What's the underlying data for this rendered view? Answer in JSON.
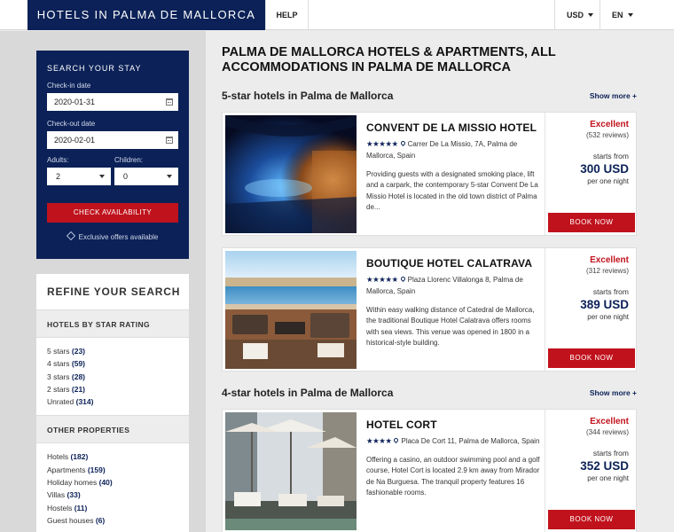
{
  "header": {
    "logo": "HOTELS IN PALMA DE MALLORCA",
    "help": "HELP",
    "currency": "USD",
    "language": "EN"
  },
  "search": {
    "title": "SEARCH YOUR STAY",
    "checkin_label": "Check-in date",
    "checkin_value": "2020-01-31",
    "checkout_label": "Check-out date",
    "checkout_value": "2020-02-01",
    "adults_label": "Adults:",
    "adults_value": "2",
    "children_label": "Children:",
    "children_value": "0",
    "button": "CHECK AVAILABILITY",
    "exclusive": "Exclusive offers available"
  },
  "refine": {
    "title": "REFINE YOUR SEARCH",
    "star_heading": "HOTELS BY STAR RATING",
    "star_items": [
      {
        "label": "5 stars",
        "count": "(23)"
      },
      {
        "label": "4 stars",
        "count": "(59)"
      },
      {
        "label": "3 stars",
        "count": "(28)"
      },
      {
        "label": "2 stars",
        "count": "(21)"
      },
      {
        "label": "Unrated",
        "count": "(314)"
      }
    ],
    "other_heading": "OTHER PROPERTIES",
    "other_items": [
      {
        "label": "Hotels",
        "count": "(182)"
      },
      {
        "label": "Apartments",
        "count": "(159)"
      },
      {
        "label": "Holiday homes",
        "count": "(40)"
      },
      {
        "label": "Villas",
        "count": "(33)"
      },
      {
        "label": "Hostels",
        "count": "(11)"
      },
      {
        "label": "Guest houses",
        "count": "(6)"
      }
    ]
  },
  "main": {
    "title": "PALMA DE MALLORCA HOTELS & APARTMENTS, ALL ACCOMMODATIONS IN PALMA DE MALLORCA",
    "section5": "5-star hotels in Palma de Mallorca",
    "section4": "4-star hotels in Palma de Mallorca",
    "show_more": "Show more +"
  },
  "hotels": [
    {
      "name": "CONVENT DE LA MISSIO HOTEL",
      "stars": "★★★★★",
      "address": "Carrer De La Missio, 7A, Palma de Mallorca, Spain",
      "description": "Providing guests with a designated smoking place, lift and a carpark, the contemporary 5-star Convent De La Missio Hotel is located in the old town district of Palma de...",
      "rating": "Excellent",
      "reviews": "(532 reviews)",
      "starts_from": "starts from",
      "price": "300 USD",
      "per_night": "per one night",
      "button": "BOOK NOW"
    },
    {
      "name": "BOUTIQUE HOTEL CALATRAVA",
      "stars": "★★★★★",
      "address": "Plaza Llorenc Villalonga 8, Palma de Mallorca, Spain",
      "description": "Within easy walking distance of Catedral de Mallorca, the traditional Boutique Hotel Calatrava offers rooms with sea views. This venue was opened in 1800 in a historical-style building.",
      "rating": "Excellent",
      "reviews": "(312 reviews)",
      "starts_from": "starts from",
      "price": "389 USD",
      "per_night": "per one night",
      "button": "BOOK NOW"
    },
    {
      "name": "HOTEL CORT",
      "stars": "★★★★",
      "address": "Placa De Cort 11, Palma de Mallorca, Spain",
      "description": "Offering a casino, an outdoor swimming pool and a golf course, Hotel Cort is located 2.9 km away from Mirador de Na Burguesa. The tranquil property features 16 fashionable rooms.",
      "rating": "Excellent",
      "reviews": "(344 reviews)",
      "starts_from": "starts from",
      "price": "352 USD",
      "per_night": "per one night",
      "button": "BOOK NOW"
    }
  ]
}
